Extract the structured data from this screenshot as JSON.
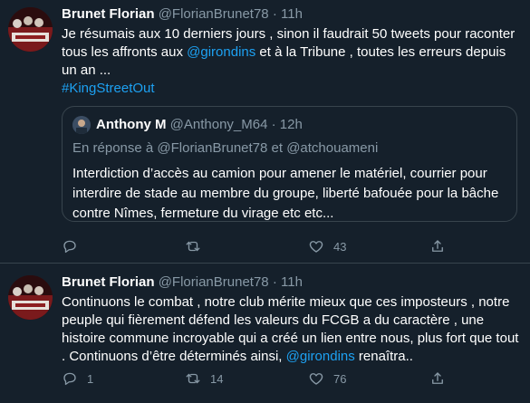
{
  "tweets": [
    {
      "name": "Brunet Florian",
      "handle": "@FlorianBrunet78",
      "sep": "·",
      "time": "11h",
      "text_a": "Je résumais aux 10 derniers jours , sinon il faudrait 50 tweets pour raconter tous les affronts aux ",
      "mention": "@girondins",
      "text_b": " et à la Tribune , toutes les erreurs depuis un an ...",
      "hashtag": "#KingStreetOut",
      "quote": {
        "name": "Anthony M",
        "handle": "@Anthony_M64",
        "sep": "·",
        "time": "12h",
        "reply": "En réponse à @FlorianBrunet78  et  @atchouameni",
        "text": "Interdiction d’accès au camion pour amener le matériel, courrier pour interdire de stade au membre du groupe, liberté bafouée pour la bâche contre Nîmes, fermeture du virage etc etc..."
      },
      "counts": {
        "reply": "",
        "retweet": "",
        "like": "43"
      }
    },
    {
      "name": "Brunet Florian",
      "handle": "@FlorianBrunet78",
      "sep": "·",
      "time": "11h",
      "text_a": "Continuons le combat , notre club mérite mieux que ces imposteurs , notre peuple qui fièrement défend les valeurs du FCGB a du caractère , une histoire commune incroyable qui a créé un lien entre nous, plus fort que tout . Continuons d’être déterminés ainsi, ",
      "mention": "@girondins",
      "text_b": " renaîtra..",
      "counts": {
        "reply": "1",
        "retweet": "14",
        "like": "76"
      }
    }
  ],
  "icons": [
    "reply-icon",
    "retweet-icon",
    "like-icon",
    "share-icon"
  ],
  "colors": {
    "background": "#15202b",
    "accent": "#1da1f2",
    "muted": "#8899a6",
    "border": "#38444d"
  }
}
